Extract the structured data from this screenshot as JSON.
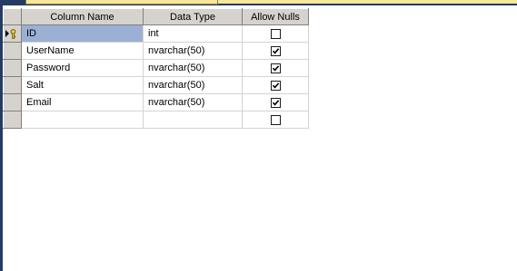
{
  "grid": {
    "headers": {
      "column_name": "Column Name",
      "data_type": "Data Type",
      "allow_nulls": "Allow Nulls"
    },
    "rows": [
      {
        "name": "ID",
        "type": "int",
        "allow_nulls": false,
        "primary_key": true,
        "current": true
      },
      {
        "name": "UserName",
        "type": "nvarchar(50)",
        "allow_nulls": true
      },
      {
        "name": "Password",
        "type": "nvarchar(50)",
        "allow_nulls": true
      },
      {
        "name": "Salt",
        "type": "nvarchar(50)",
        "allow_nulls": true
      },
      {
        "name": "Email",
        "type": "nvarchar(50)",
        "allow_nulls": true
      },
      {
        "name": "",
        "type": "",
        "allow_nulls": false
      }
    ]
  },
  "colors": {
    "header_bg": "#d6d3ce",
    "selection": "#9cb0d6",
    "tab_bg": "#f7e79a",
    "chrome": "#253b63"
  }
}
